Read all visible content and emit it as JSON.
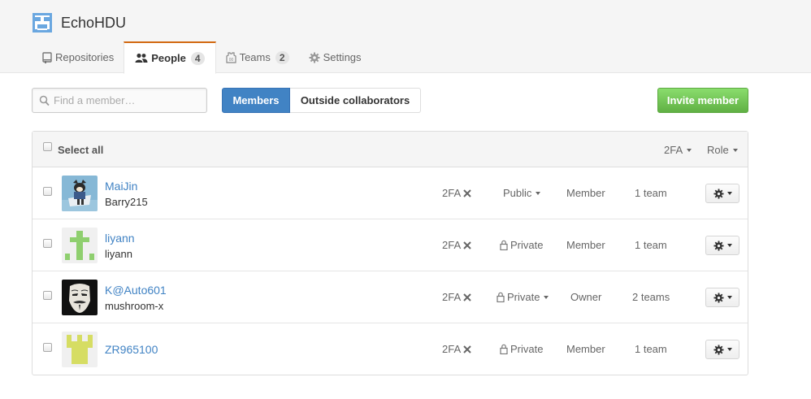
{
  "org": {
    "name": "EchoHDU",
    "logo_icon": "org-grid-logo-icon"
  },
  "tabs": [
    {
      "label": "Repositories",
      "icon": "repo-icon",
      "count": "",
      "active": false
    },
    {
      "label": "People",
      "icon": "people-icon",
      "count": "4",
      "active": true
    },
    {
      "label": "Teams",
      "icon": "jersey-icon",
      "count": "2",
      "active": false
    },
    {
      "label": "Settings",
      "icon": "gear-icon",
      "count": "",
      "active": false
    }
  ],
  "search": {
    "placeholder": "Find a member…",
    "value": ""
  },
  "filters": {
    "members": "Members",
    "outside": "Outside collaborators"
  },
  "invite_label": "Invite member",
  "table": {
    "select_all": "Select all",
    "filter_2fa": "2FA",
    "filter_role": "Role"
  },
  "members": [
    {
      "name": "MaiJin",
      "login": "Barry215",
      "twofa": "2FA",
      "visibility": "Public",
      "vis_dropdown": true,
      "lock": false,
      "role": "Member",
      "teams": "1 team",
      "avatar": "cartoon-avatar"
    },
    {
      "name": "liyann",
      "login": "liyann",
      "twofa": "2FA",
      "visibility": "Private",
      "vis_dropdown": false,
      "lock": true,
      "role": "Member",
      "teams": "1 team",
      "avatar": "green-identicon"
    },
    {
      "name": "K@Auto601",
      "login": "mushroom-x",
      "twofa": "2FA",
      "visibility": "Private",
      "vis_dropdown": true,
      "lock": true,
      "role": "Owner",
      "teams": "2 teams",
      "avatar": "mask-avatar"
    },
    {
      "name": "ZR965100",
      "login": "",
      "twofa": "2FA",
      "visibility": "Private",
      "vis_dropdown": false,
      "lock": true,
      "role": "Member",
      "teams": "1 team",
      "avatar": "yellow-identicon"
    }
  ],
  "colors": {
    "accent_blue": "#4183c4",
    "invite_green": "#60b044",
    "tab_active_border": "#d26911"
  }
}
